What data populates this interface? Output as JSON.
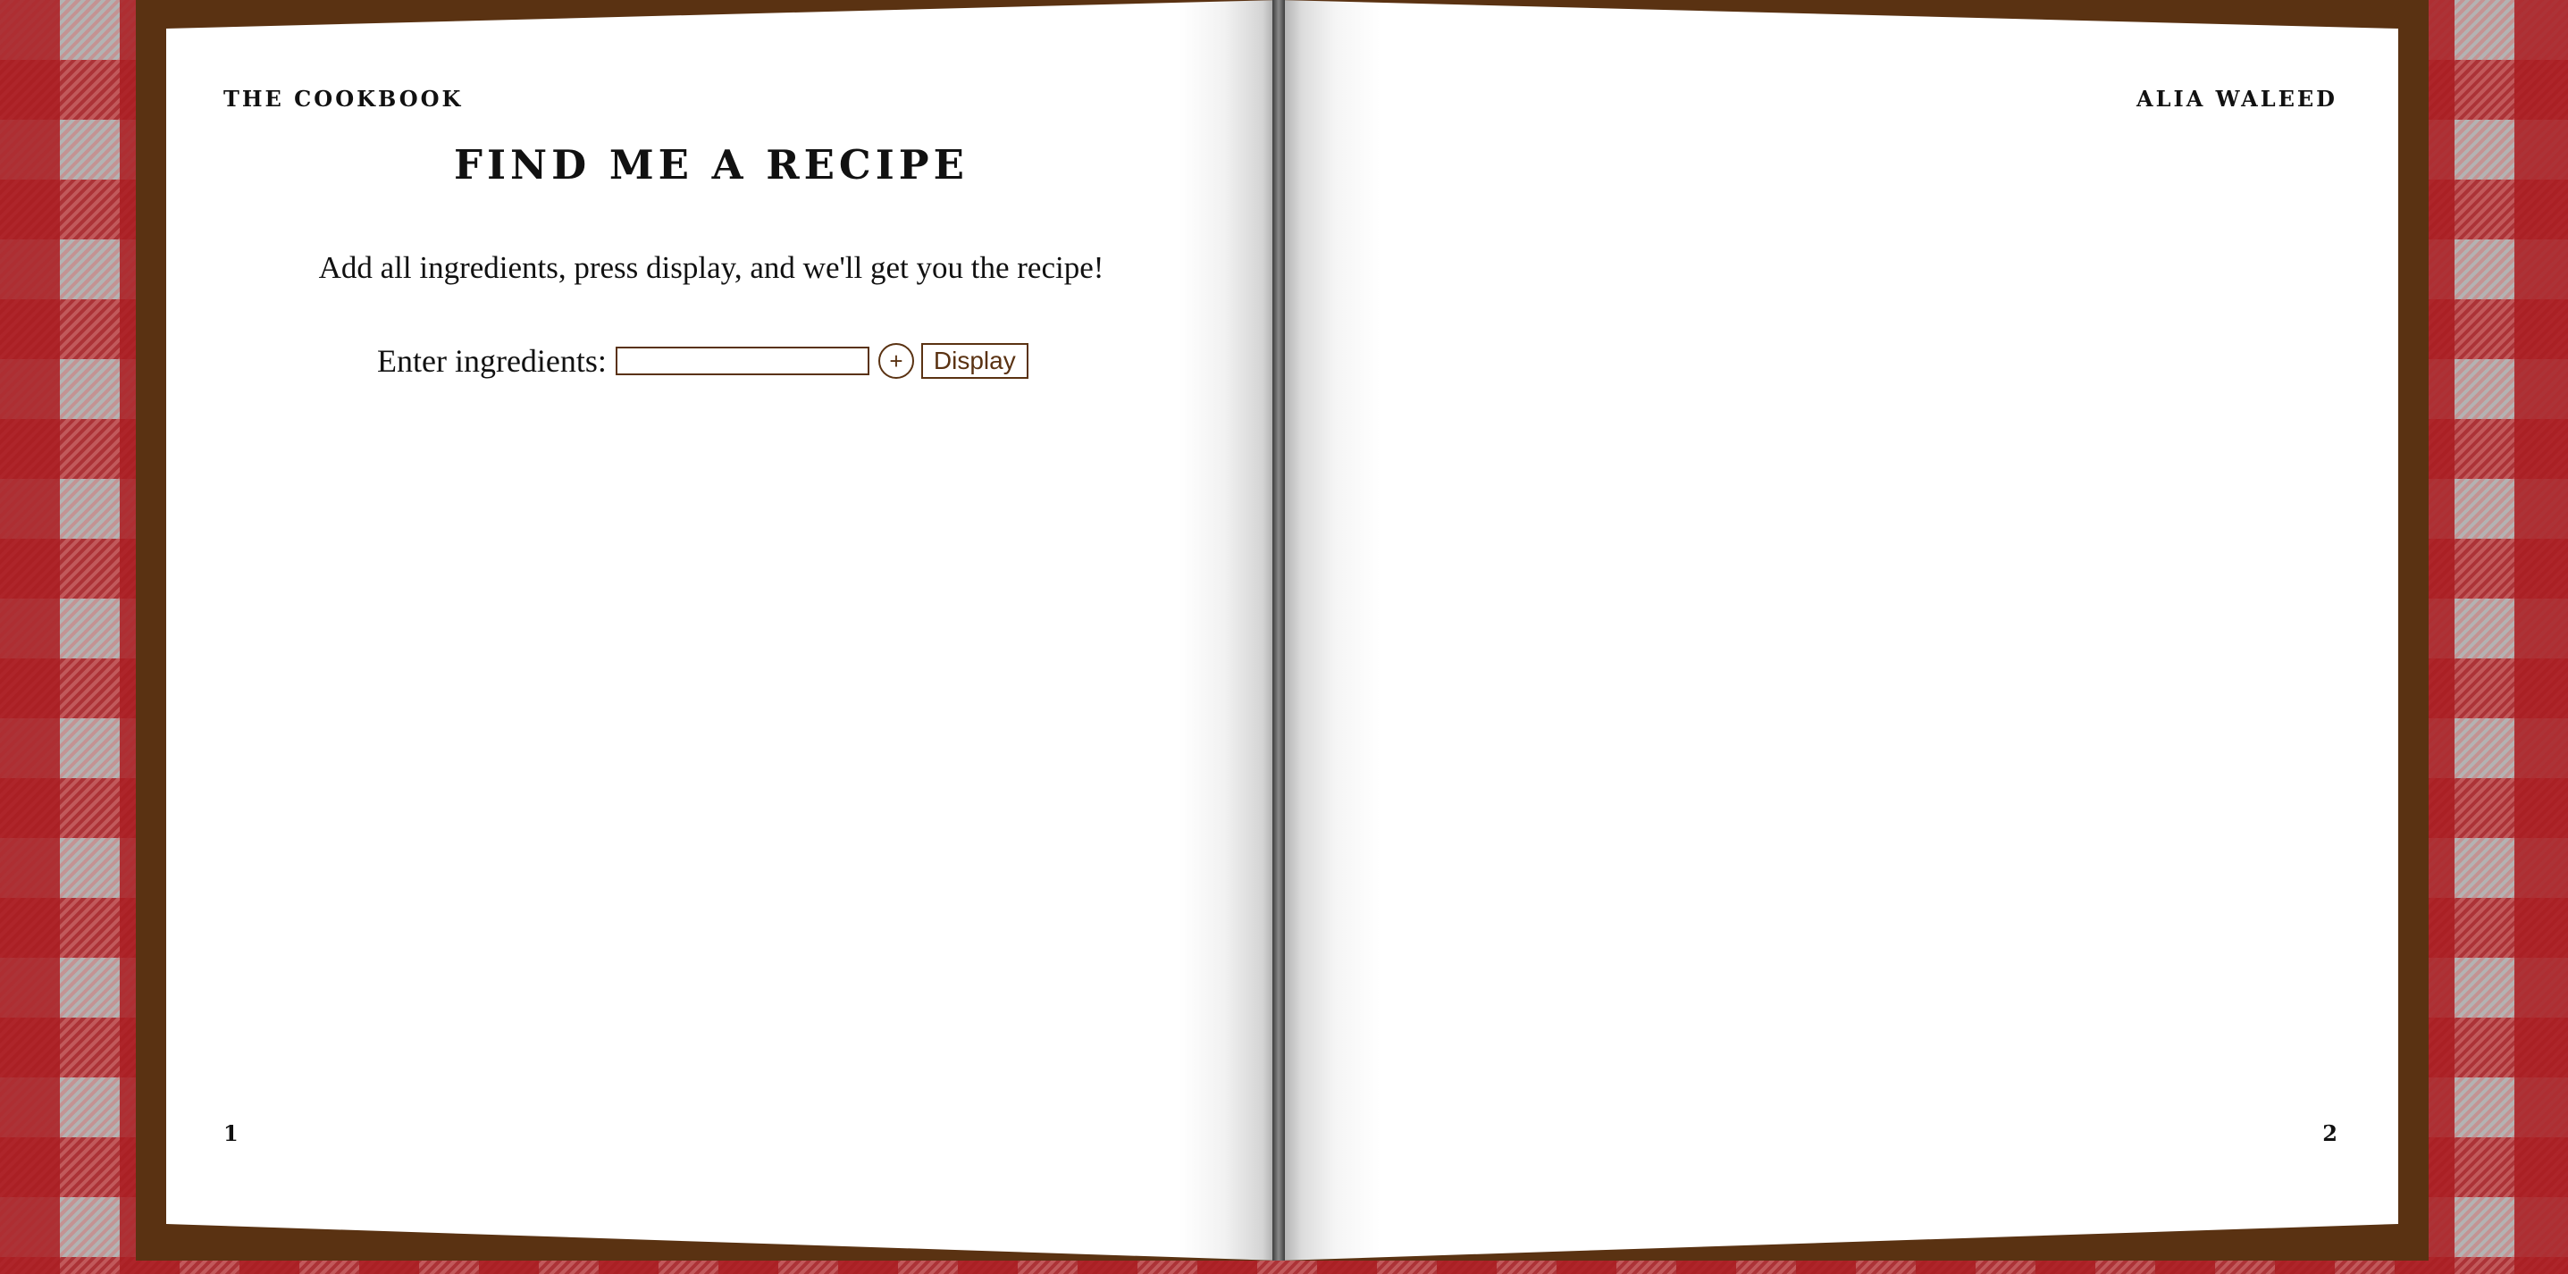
{
  "book": {
    "left_header": "THE COOKBOOK",
    "right_header": "ALIA WALEED",
    "left_page_number": "1",
    "right_page_number": "2"
  },
  "recipe_form": {
    "title": "FIND ME A RECIPE",
    "instructions": "Add all ingredients, press display, and we'll get you the recipe!",
    "ingredient_label": "Enter ingredients:",
    "ingredient_value": "",
    "ingredient_placeholder": "",
    "add_label": "+",
    "display_label": "Display"
  },
  "colors": {
    "cover_brown": "#5a3212",
    "tablecloth_red": "#aa1c21",
    "tablecloth_grey": "#b3b3b3",
    "button_brown": "#5a3212"
  }
}
